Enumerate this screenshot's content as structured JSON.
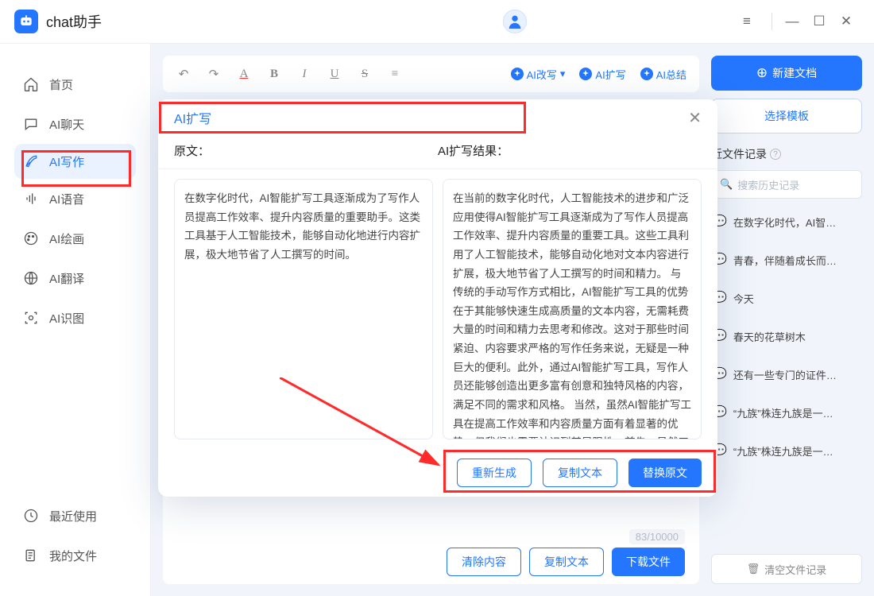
{
  "app": {
    "title": "chat助手"
  },
  "window": {
    "menu": "≡",
    "min": "—",
    "max": "☐",
    "close": "✕"
  },
  "sidebar": {
    "items": [
      {
        "label": "首页"
      },
      {
        "label": "AI聊天"
      },
      {
        "label": "AI写作"
      },
      {
        "label": "AI语音"
      },
      {
        "label": "AI绘画"
      },
      {
        "label": "AI翻译"
      },
      {
        "label": "AI识图"
      }
    ],
    "bottom": [
      {
        "label": "最近使用"
      },
      {
        "label": "我的文件"
      }
    ]
  },
  "toolbar": {
    "ai_rewrite": "AI改写",
    "ai_expand": "AI扩写",
    "ai_summary": "AI总结"
  },
  "editor": {
    "counter": "83/10000",
    "btn_clear": "清除内容",
    "btn_copy": "复制文本",
    "btn_download": "下载文件"
  },
  "right": {
    "new_doc": "新建文档",
    "choose_tpl": "选择模板",
    "recent_header": "近文件记录",
    "search_placeholder": "搜索历史记录",
    "files": [
      "在数字化时代，AI智…",
      "青春，伴随着成长而…",
      "今天",
      "春天的花草树木",
      "还有一些专门的证件…",
      "“九族”株连九族是一…",
      "“九族”株连九族是一…"
    ],
    "clear": "清空文件记录"
  },
  "modal": {
    "title": "AI扩写",
    "label_left": "原文：",
    "label_right": "AI扩写结果：",
    "text_left": "在数字化时代，AI智能扩写工具逐渐成为了写作人员提高工作效率、提升内容质量的重要助手。这类工具基于人工智能技术，能够自动化地进行内容扩展，极大地节省了人工撰写的时间。",
    "text_right": "在当前的数字化时代，人工智能技术的进步和广泛应用使得AI智能扩写工具逐渐成为了写作人员提高工作效率、提升内容质量的重要工具。这些工具利用了人工智能技术，能够自动化地对文本内容进行扩展，极大地节省了人工撰写的时间和精力。 与传统的手动写作方式相比，AI智能扩写工具的优势在于其能够快速生成高质量的文本内容，无需耗费大量的时间和精力去思考和修改。这对于那些时间紧迫、内容要求严格的写作任务来说，无疑是一种巨大的便利。此外，通过AI智能扩写工具，写作人员还能够创造出更多富有创意和独特风格的内容，满足不同的需求和风格。 当然，虽然AI智能扩写工具在提高工作效率和内容质量方面有着显著的优势，但我们也需要认识到其局限性。首先，虽然工具能够自动化地生成内容，但它的表达方式和语言风格可能缺乏一定的自然度和生动",
    "btn_regen": "重新生成",
    "btn_copy": "复制文本",
    "btn_replace": "替换原文"
  }
}
